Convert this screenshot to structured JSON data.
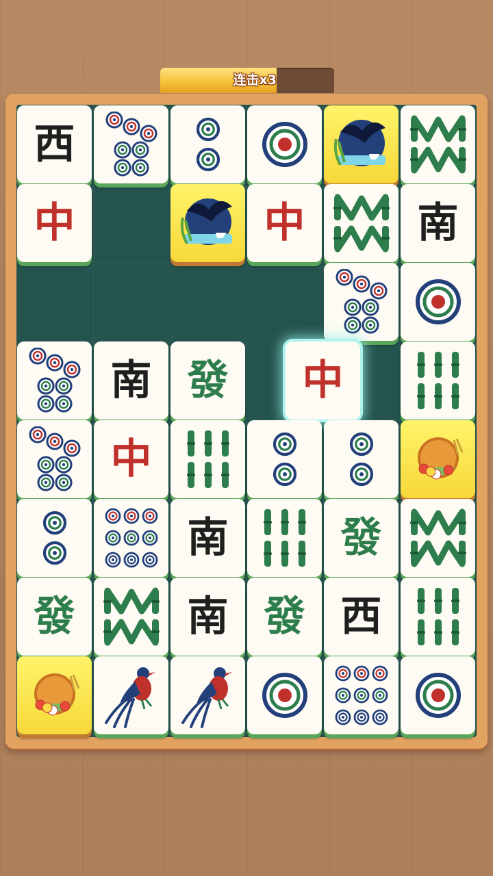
{
  "combo": {
    "label": "连击x3",
    "progress": 0.67
  },
  "board": {
    "cols": 6,
    "rows": 8
  },
  "colors": {
    "red": "#c0312b",
    "black": "#1f1f1f",
    "green": "#2e7d4c",
    "dot_blue": "#23407a",
    "gold": "#f7d83a",
    "felt": "#25534d"
  },
  "tiles": [
    {
      "row": 0,
      "col": 0,
      "kind": "char",
      "text": "西",
      "color": "black"
    },
    {
      "row": 0,
      "col": 1,
      "kind": "dots",
      "count": 7
    },
    {
      "row": 0,
      "col": 2,
      "kind": "dots",
      "count": 2
    },
    {
      "row": 0,
      "col": 3,
      "kind": "dots",
      "count": 1
    },
    {
      "row": 0,
      "col": 4,
      "kind": "swallow",
      "icon": "swallow-icon"
    },
    {
      "row": 0,
      "col": 5,
      "kind": "bamboo",
      "count": 8
    },
    {
      "row": 1,
      "col": 0,
      "kind": "char",
      "text": "中",
      "color": "red"
    },
    {
      "row": 1,
      "col": 2,
      "kind": "swallow",
      "icon": "swallow-icon"
    },
    {
      "row": 1,
      "col": 3,
      "kind": "char",
      "text": "中",
      "color": "red"
    },
    {
      "row": 1,
      "col": 4,
      "kind": "bamboo",
      "count": 8
    },
    {
      "row": 1,
      "col": 5,
      "kind": "char",
      "text": "南",
      "color": "black"
    },
    {
      "row": 2,
      "col": 4,
      "kind": "dots",
      "count": 7
    },
    {
      "row": 2,
      "col": 5,
      "kind": "dots",
      "count": 1
    },
    {
      "row": 3,
      "col": 0,
      "kind": "dots",
      "count": 7
    },
    {
      "row": 3,
      "col": 1,
      "kind": "char",
      "text": "南",
      "color": "black"
    },
    {
      "row": 3,
      "col": 2,
      "kind": "char",
      "text": "發",
      "color": "green"
    },
    {
      "row": 3,
      "col": 3.5,
      "kind": "char",
      "text": "中",
      "color": "red",
      "selected": true
    },
    {
      "row": 3,
      "col": 5,
      "kind": "bamboo",
      "count": 6
    },
    {
      "row": 4,
      "col": 0,
      "kind": "dots",
      "count": 7
    },
    {
      "row": 4,
      "col": 1,
      "kind": "char",
      "text": "中",
      "color": "red"
    },
    {
      "row": 4,
      "col": 2,
      "kind": "bamboo",
      "count": 6
    },
    {
      "row": 4,
      "col": 3,
      "kind": "dots",
      "count": 2
    },
    {
      "row": 4,
      "col": 4,
      "kind": "dots",
      "count": 2
    },
    {
      "row": 4,
      "col": 5,
      "kind": "season",
      "icon": "flower-basket-icon"
    },
    {
      "row": 5,
      "col": 0,
      "kind": "dots",
      "count": 2
    },
    {
      "row": 5,
      "col": 1,
      "kind": "dots",
      "count": 9
    },
    {
      "row": 5,
      "col": 2,
      "kind": "char",
      "text": "南",
      "color": "black"
    },
    {
      "row": 5,
      "col": 3,
      "kind": "bamboo",
      "count": 6
    },
    {
      "row": 5,
      "col": 4,
      "kind": "char",
      "text": "發",
      "color": "green"
    },
    {
      "row": 5,
      "col": 5,
      "kind": "bamboo",
      "count": 8
    },
    {
      "row": 6,
      "col": 0,
      "kind": "char",
      "text": "發",
      "color": "green"
    },
    {
      "row": 6,
      "col": 1,
      "kind": "bamboo",
      "count": 8
    },
    {
      "row": 6,
      "col": 2,
      "kind": "char",
      "text": "南",
      "color": "black"
    },
    {
      "row": 6,
      "col": 3,
      "kind": "char",
      "text": "發",
      "color": "green"
    },
    {
      "row": 6,
      "col": 4,
      "kind": "char",
      "text": "西",
      "color": "black"
    },
    {
      "row": 6,
      "col": 5,
      "kind": "bamboo",
      "count": 6
    },
    {
      "row": 7,
      "col": 0,
      "kind": "season",
      "icon": "flower-basket-icon"
    },
    {
      "row": 7,
      "col": 1,
      "kind": "bird",
      "icon": "bird-icon"
    },
    {
      "row": 7,
      "col": 2,
      "kind": "bird",
      "icon": "bird-icon"
    },
    {
      "row": 7,
      "col": 3,
      "kind": "dots",
      "count": 1
    },
    {
      "row": 7,
      "col": 4,
      "kind": "dots",
      "count": 9
    },
    {
      "row": 7,
      "col": 5,
      "kind": "dots",
      "count": 1
    }
  ]
}
